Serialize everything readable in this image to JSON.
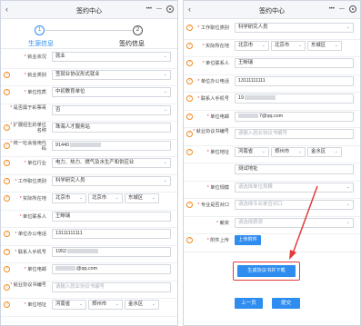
{
  "left": {
    "header": {
      "title": "签约中心",
      "menu": "•••",
      "minimize": "—"
    },
    "steps": {
      "step1_num": "1",
      "step1_label": "生源信息",
      "step2_num": "2",
      "step2_label": "签约信息"
    },
    "rows": [
      {
        "label": "就业状况",
        "required": true,
        "q": false,
        "value": "就业",
        "select": true
      },
      {
        "label": "就业类别",
        "required": true,
        "q": true,
        "value": "签就业协议形式就业",
        "select": true
      },
      {
        "label": "单位性质",
        "required": true,
        "q": true,
        "value": "中初教育单位",
        "select": true
      },
      {
        "label": "是否属于彩票哥",
        "required": true,
        "q": false,
        "value": "否",
        "select": true
      },
      {
        "label": "扩展招生的单位名称",
        "required": true,
        "q": true,
        "value": "珠海人才服务站",
        "select": false
      },
      {
        "label": "统一社会信用代码",
        "required": true,
        "q": true,
        "value": "91440",
        "select": false,
        "blur": true
      },
      {
        "label": "单位行业",
        "required": true,
        "q": true,
        "value": "电力、热力、燃气及水生产和供应业",
        "select": true
      },
      {
        "label": "工作职位类别",
        "required": true,
        "q": true,
        "value": "科学研究人员",
        "select": true
      },
      {
        "label": "实际所在地",
        "required": true,
        "q": true,
        "value": "",
        "select": false,
        "addr": [
          "北京市",
          "北京市",
          "东城区"
        ]
      },
      {
        "label": "单位联系人",
        "required": true,
        "q": false,
        "value": "王晰瑞",
        "select": false
      },
      {
        "label": "单位办公电话",
        "required": true,
        "q": true,
        "value": "13111111111",
        "select": false
      },
      {
        "label": "联系人手机号",
        "required": true,
        "q": true,
        "value": "1952",
        "select": false,
        "blur": true
      },
      {
        "label": "单位电邮",
        "required": true,
        "q": true,
        "value": "@qq.com",
        "select": false,
        "blur_prefix": true
      },
      {
        "label": "就业协议书编号",
        "required": true,
        "q": true,
        "value": "请输入就业协议书编号",
        "select": false,
        "placeholder": true
      },
      {
        "label": "单位地址",
        "required": true,
        "q": true,
        "value": "",
        "select": false,
        "addr": [
          "河南省",
          "郑州市",
          "金水区"
        ]
      }
    ]
  },
  "right": {
    "header": {
      "title": "签约中心",
      "menu": "•••",
      "minimize": "—"
    },
    "rows": [
      {
        "label": "工作职位类别",
        "required": true,
        "q": true,
        "value": "科学研究人员",
        "select": true
      },
      {
        "label": "实际所在地",
        "required": true,
        "q": true,
        "value": "",
        "addr": [
          "北京市",
          "北京市",
          "东城区"
        ]
      },
      {
        "label": "单位联系人",
        "required": true,
        "q": true,
        "value": "王晰瑞"
      },
      {
        "label": "单位办公电话",
        "required": true,
        "q": true,
        "value": "13111111111"
      },
      {
        "label": "联系人手机号",
        "required": true,
        "q": true,
        "value": "19",
        "blur": true
      },
      {
        "label": "单位电邮",
        "required": true,
        "q": true,
        "value": "7@qq.com",
        "blur_prefix": true
      },
      {
        "label": "就业协议书编号",
        "required": true,
        "q": true,
        "value": "请输入就业协议书编号",
        "placeholder": true
      },
      {
        "label": "单位地址",
        "required": true,
        "q": true,
        "value": "",
        "addr": [
          "河南省",
          "郑州市",
          "金水区"
        ]
      },
      {
        "label": "",
        "required": false,
        "q": false,
        "value": "测试地址"
      },
      {
        "label": "单位规模",
        "required": true,
        "q": false,
        "value": "请选择单位规模",
        "placeholder": true,
        "select": true
      },
      {
        "label": "专业是否对口",
        "required": true,
        "q": true,
        "value": "请选择专业是否对口",
        "placeholder": true,
        "select": true
      },
      {
        "label": "薪资",
        "required": true,
        "q": false,
        "value": "请选择薪资",
        "placeholder": true,
        "select": true
      },
      {
        "label": "附件上传",
        "required": true,
        "q": true,
        "value": "",
        "upload": true
      }
    ],
    "upload_label": "上传附件",
    "generate_label": "生成协议书并下载",
    "prev_label": "上一页",
    "submit_label": "提交"
  }
}
